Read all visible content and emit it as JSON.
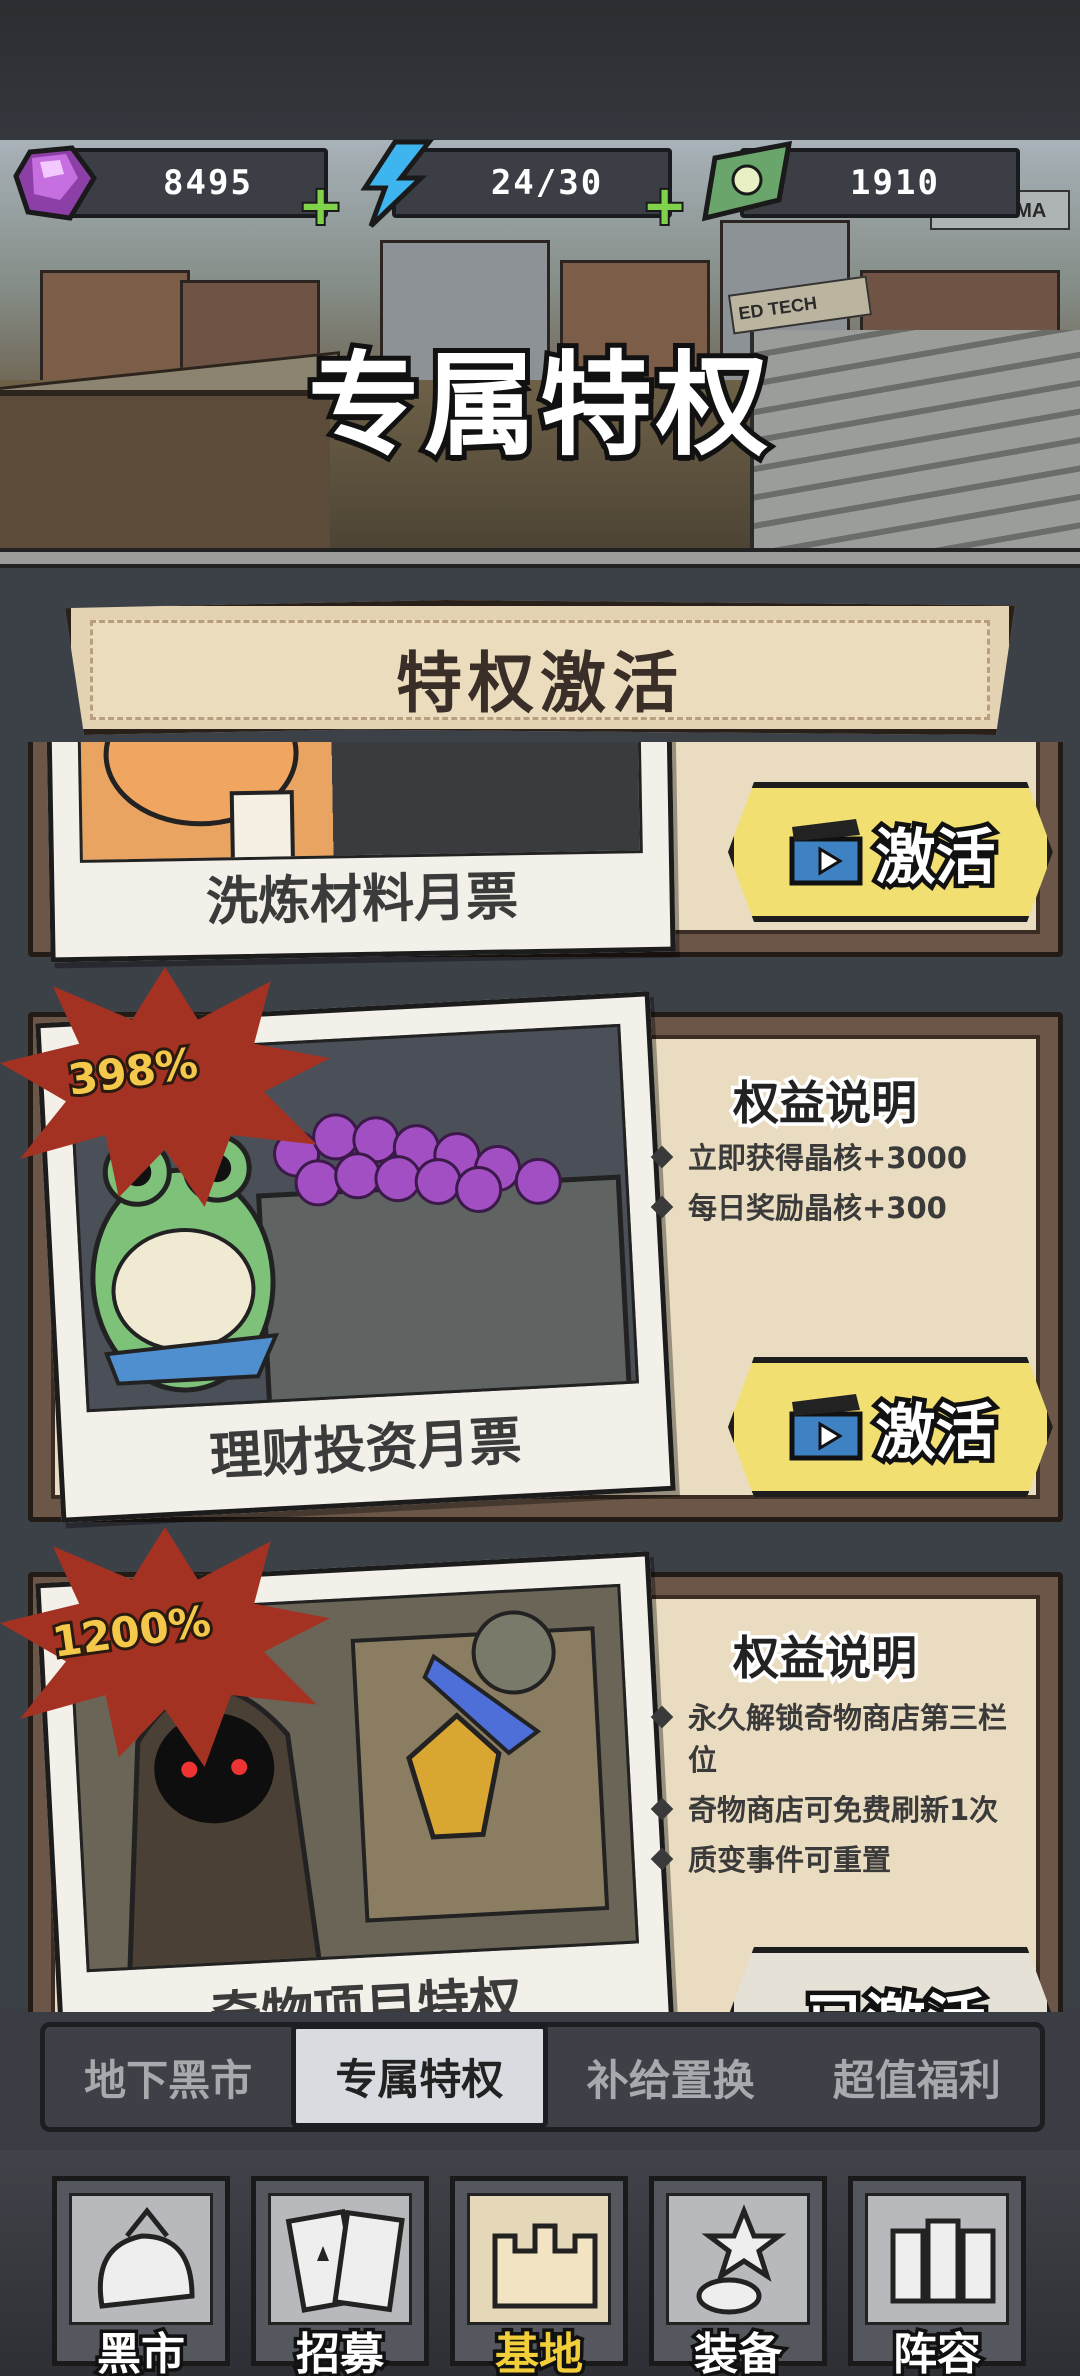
{
  "resources": [
    {
      "icon": "crystal-icon",
      "value": "8495"
    },
    {
      "icon": "energy-icon",
      "value": "24/30"
    },
    {
      "icon": "cash-icon",
      "value": "1910"
    }
  ],
  "header": {
    "title": "专属特权"
  },
  "section": {
    "title": "特权激活"
  },
  "cards": [
    {
      "name": "洗炼材料月票",
      "button": "激活"
    },
    {
      "name": "理财投资月票",
      "badge": "398%",
      "benefit_title": "权益说明",
      "benefits": [
        "立即获得晶核+3000",
        "每日奖励晶核+300"
      ],
      "button": "激活"
    },
    {
      "name": "奇物项目特权",
      "badge": "1200%",
      "benefit_title": "权益说明",
      "benefits": [
        "永久解锁奇物商店第三栏位",
        "奇物商店可免费刷新1次",
        "质变事件可重置"
      ],
      "button": "已激活"
    }
  ],
  "tabs": [
    {
      "label": "地下黑市",
      "active": false
    },
    {
      "label": "专属特权",
      "active": true
    },
    {
      "label": "补给置换",
      "active": false
    },
    {
      "label": "超值福利",
      "active": false
    }
  ],
  "nav": [
    {
      "label": "黑市",
      "icon": "money-bag-icon"
    },
    {
      "label": "招募",
      "icon": "cards-icon"
    },
    {
      "label": "基地",
      "icon": "castle-icon",
      "active": true
    },
    {
      "label": "装备",
      "icon": "equipment-icon"
    },
    {
      "label": "阵容",
      "icon": "team-icon"
    }
  ],
  "colors": {
    "accent_yellow": "#f2df72",
    "badge_red": "#a43223",
    "paper": "#eadcc0"
  }
}
